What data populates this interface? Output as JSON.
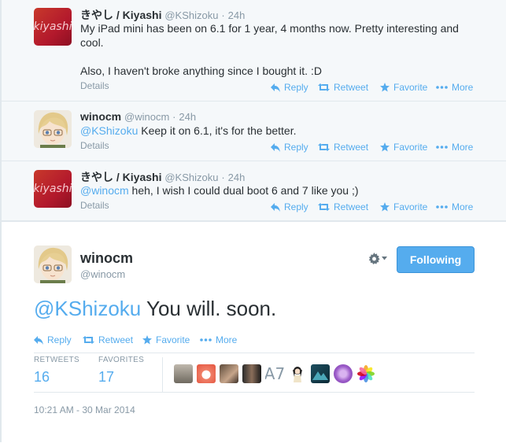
{
  "tweets": [
    {
      "name": "きやし / Kiyashi",
      "handle": "@KShizoku",
      "time": "24h",
      "avatar_text": "kiyashi",
      "line1": "My iPad mini has been on 6.1 for 1 year, 4 months now. Pretty interesting and",
      "line2": "cool.",
      "line3": "Also, I haven't broke anything since I bought it. :D",
      "details": "Details"
    },
    {
      "name": "winocm",
      "handle": "@winocm",
      "time": "24h",
      "mention": "@KShizoku",
      "text": " Keep it on 6.1, it's for the better.",
      "details": "Details"
    },
    {
      "name": "きやし / Kiyashi",
      "handle": "@KShizoku",
      "time": "24h",
      "avatar_text": "kiyashi",
      "mention": "@winocm",
      "text": " heh, I wish I could dual boot 6 and 7 like you ;)",
      "details": "Details"
    }
  ],
  "actions": {
    "reply": "Reply",
    "retweet": "Retweet",
    "favorite": "Favorite",
    "more": "More"
  },
  "expanded": {
    "name": "winocm",
    "handle": "@winocm",
    "follow_label": "Following",
    "mention": "@KShizoku",
    "text": " You will. soon.",
    "stats": {
      "retweets_label": "RETWEETS",
      "retweets_value": "16",
      "favorites_label": "FAVORITES",
      "favorites_value": "17"
    },
    "faces_text": "A7",
    "timestamp": "10:21 AM - 30 Mar 2014"
  },
  "colors": {
    "accent": "#55acee",
    "muted": "#8899a6",
    "text": "#292f33",
    "stream_bg": "#f5f8fa",
    "border": "#e1e8ed"
  },
  "icons": [
    "reply-icon",
    "retweet-icon",
    "favorite-icon",
    "more-icon",
    "gear-icon",
    "chevron-down-icon"
  ]
}
